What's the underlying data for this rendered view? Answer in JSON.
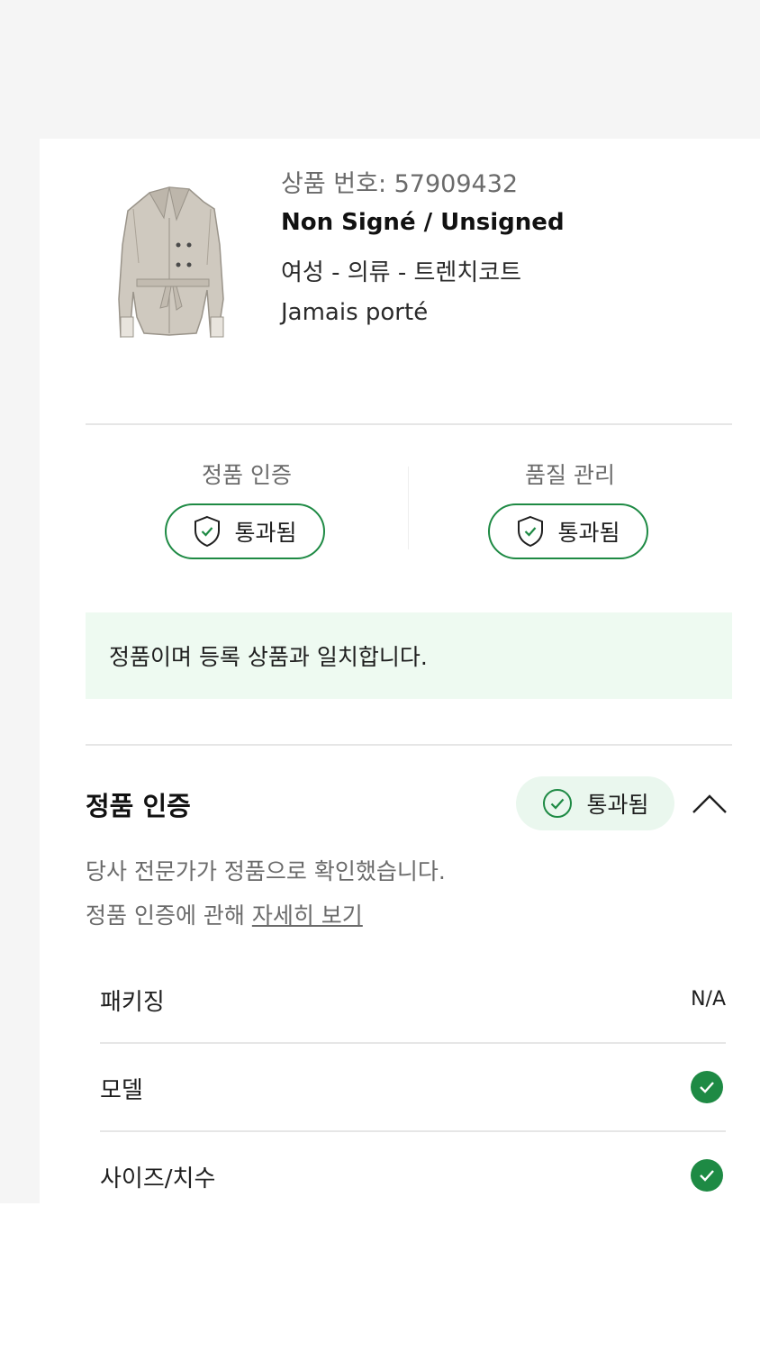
{
  "product": {
    "number": "상품 번호: 57909432",
    "brand": "Non Signé / Unsigned",
    "category": "여성 - 의류 - 트렌치코트",
    "condition": "Jamais porté"
  },
  "checks": [
    {
      "label": "정품 인증",
      "status": "통과됨",
      "icon": "shield-check-icon"
    },
    {
      "label": "품질 관리",
      "status": "통과됨",
      "icon": "shield-check-icon"
    }
  ],
  "notice": "정품이며 등록 상품과 일치합니다.",
  "auth_section": {
    "title": "정품 인증",
    "badge": "통과됨",
    "desc1": "당사 전문가가 정품으로 확인했습니다.",
    "desc2_prefix": "정품 인증에 관해 ",
    "desc2_link": "자세히 보기",
    "rows": [
      {
        "label": "패키징",
        "value": "N/A"
      },
      {
        "label": "모델",
        "value": "",
        "icon": "check-circle-icon"
      },
      {
        "label": "사이즈/치수",
        "value": "",
        "icon": "check-circle-icon"
      }
    ]
  },
  "colors": {
    "accent_green": "#1e8a44",
    "notice_bg": "#eefaf1"
  }
}
